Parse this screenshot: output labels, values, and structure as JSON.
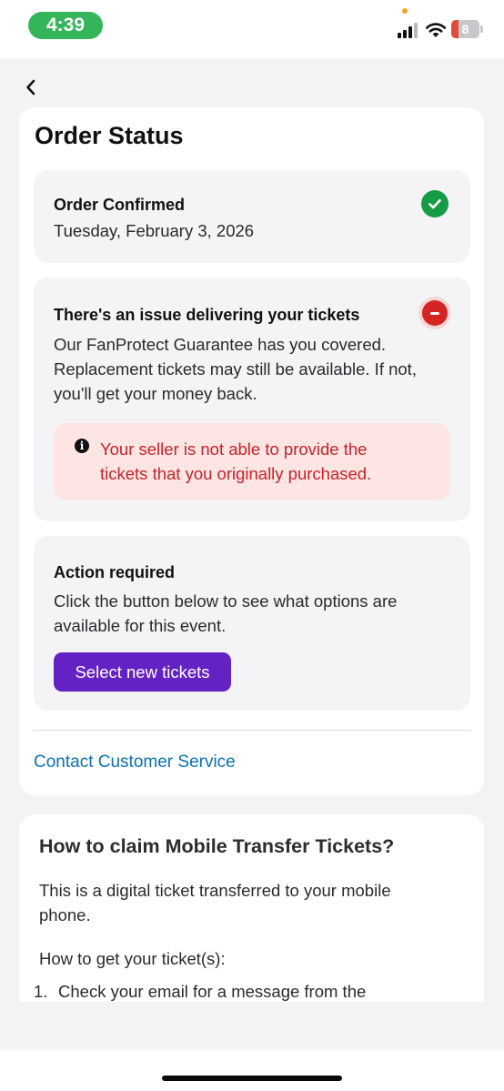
{
  "status_bar": {
    "time": "4:39",
    "battery": "8"
  },
  "colors": {
    "accent": "#6422c5",
    "success": "#169b46",
    "error": "#d52424",
    "error_text": "#c6232a",
    "error_bg": "#fce5e3",
    "link": "#0d6fb5",
    "time_pill": "#35b55a"
  },
  "nav": {
    "back_icon": "chevron-left-icon"
  },
  "order_status": {
    "title": "Order Status",
    "confirmed": {
      "heading": "Order Confirmed",
      "date": "Tuesday, February 3, 2026",
      "icon": "check-circle-icon"
    },
    "issue": {
      "heading": "There's an issue delivering your tickets",
      "body_line1": "Our FanProtect Guarantee has you covered.",
      "body_line2": "Replacement tickets may still be available. If not,",
      "body_line3": "you'll get your money back.",
      "icon": "minus-circle-icon",
      "alert": {
        "icon": "info-icon",
        "line1": "Your seller is not able to provide the",
        "line2": "tickets that you originally purchased."
      }
    },
    "action": {
      "heading": "Action required",
      "body_line1": "Click the button below to see what options are",
      "body_line2": "available for this event.",
      "button_label": "Select new tickets"
    },
    "contact_link": "Contact Customer Service"
  },
  "howto": {
    "title": "How to claim Mobile Transfer Tickets?",
    "intro_line1": "This is a digital ticket transferred to your mobile",
    "intro_line2": "phone.",
    "subheading": "How to get your ticket(s):",
    "steps": [
      {
        "number": "1.",
        "text": "Check your email for a message from the"
      }
    ]
  }
}
